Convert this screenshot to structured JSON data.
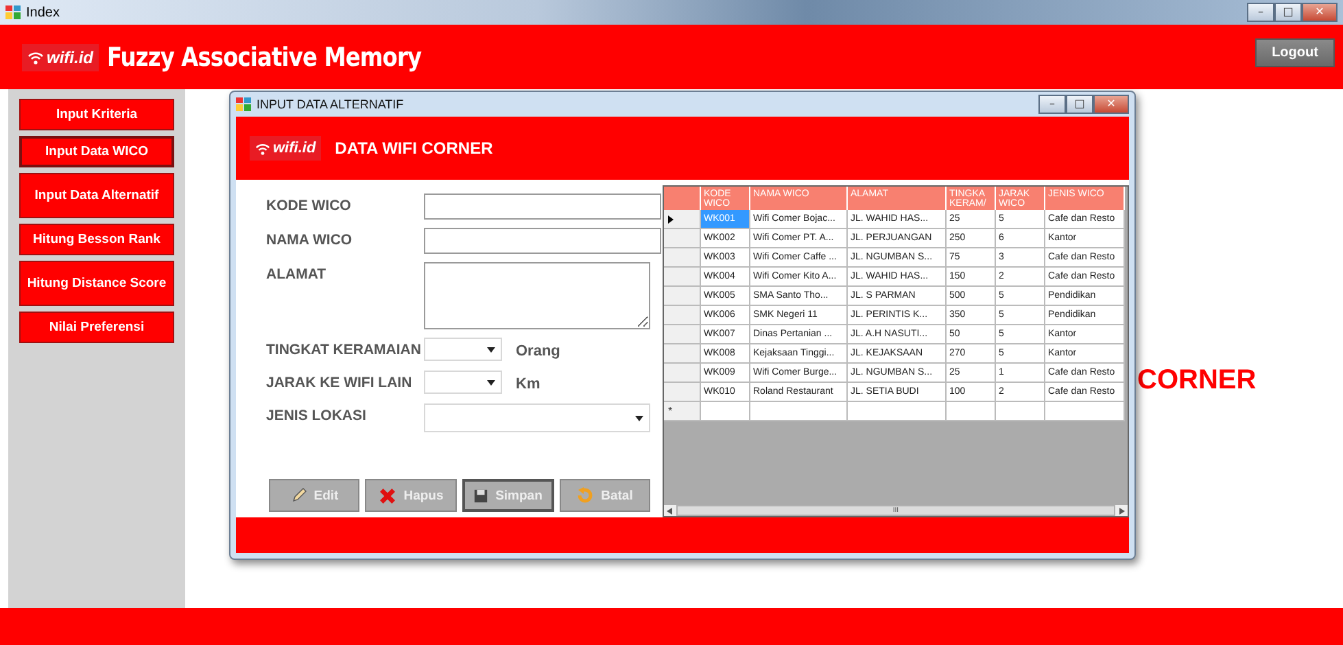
{
  "window": {
    "title": "Index",
    "controls": [
      "–",
      "□",
      "✕"
    ]
  },
  "header": {
    "logo": "wifi.id",
    "title": "Fuzzy Associative Memory",
    "logout": "Logout"
  },
  "sidebar": {
    "items": [
      {
        "label": "Input Kriteria",
        "selected": false
      },
      {
        "label": "Input Data WICO",
        "selected": true
      },
      {
        "label": "Input Data Alternatif",
        "selected": false
      },
      {
        "label": "Hitung Besson Rank",
        "selected": false
      },
      {
        "label": "Hitung Distance Score",
        "selected": false
      },
      {
        "label": "Nilai Preferensi",
        "selected": false
      }
    ]
  },
  "background_text": "CORNER",
  "child_window": {
    "title": "INPUT DATA ALTERNATIF",
    "controls": [
      "–",
      "□",
      "✕"
    ],
    "banner": {
      "logo": "wifi.id",
      "title": "DATA WIFI CORNER"
    },
    "form": {
      "fields": [
        {
          "kind": "text",
          "label": "KODE WICO"
        },
        {
          "kind": "text",
          "label": "NAMA WICO"
        },
        {
          "kind": "textarea",
          "label": "ALAMAT"
        },
        {
          "kind": "combo",
          "label": "TINGKAT KERAMAIAN",
          "unit": "Orang"
        },
        {
          "kind": "combo",
          "label": "JARAK KE WIFI LAIN",
          "unit": "Km"
        },
        {
          "kind": "combo_wide",
          "label": "JENIS LOKASI"
        }
      ],
      "buttons": [
        {
          "kind": "edit",
          "label": "Edit",
          "focused": false
        },
        {
          "kind": "delete",
          "label": "Hapus",
          "focused": false
        },
        {
          "kind": "save",
          "label": "Simpan",
          "focused": true
        },
        {
          "kind": "cancel",
          "label": "Batal",
          "focused": false
        }
      ]
    },
    "table": {
      "columns": [
        "KODE WICO",
        "NAMA WICO",
        "ALAMAT",
        "TINGKA KERAM/",
        "JARAK WICO",
        "JENIS WICO"
      ],
      "rows": [
        {
          "selected": true,
          "cells": [
            "WK001",
            "Wifi Comer Bojac...",
            "JL. WAHID HAS...",
            "25",
            "5",
            "Cafe dan Resto"
          ]
        },
        {
          "selected": false,
          "cells": [
            "WK002",
            "Wifi Comer PT. A...",
            "JL. PERJUANGAN",
            "250",
            "6",
            "Kantor"
          ]
        },
        {
          "selected": false,
          "cells": [
            "WK003",
            "Wifi Comer Caffe ...",
            "JL. NGUMBAN S...",
            "75",
            "3",
            "Cafe dan Resto"
          ]
        },
        {
          "selected": false,
          "cells": [
            "WK004",
            "Wifi Comer Kito A...",
            "JL. WAHID HAS...",
            "150",
            "2",
            "Cafe dan Resto"
          ]
        },
        {
          "selected": false,
          "cells": [
            "WK005",
            "SMA Santo Tho...",
            "JL. S PARMAN",
            "500",
            "5",
            "Pendidikan"
          ]
        },
        {
          "selected": false,
          "cells": [
            "WK006",
            "SMK Negeri 11",
            "JL. PERINTIS K...",
            "350",
            "5",
            "Pendidikan"
          ]
        },
        {
          "selected": false,
          "cells": [
            "WK007",
            "Dinas Pertanian ...",
            "JL. A.H NASUTI...",
            "50",
            "5",
            "Kantor"
          ]
        },
        {
          "selected": false,
          "cells": [
            "WK008",
            "Kejaksaan Tinggi...",
            "JL. KEJAKSAAN",
            "270",
            "5",
            "Kantor"
          ]
        },
        {
          "selected": false,
          "cells": [
            "WK009",
            "Wifi Comer Burge...",
            "JL. NGUMBAN S...",
            "25",
            "1",
            "Cafe dan Resto"
          ]
        },
        {
          "selected": false,
          "cells": [
            "WK010",
            "Roland Restaurant",
            "JL. SETIA BUDI",
            "100",
            "2",
            "Cafe dan Resto"
          ]
        }
      ],
      "new_row_marker": "*",
      "scroll_mark": "III"
    }
  }
}
